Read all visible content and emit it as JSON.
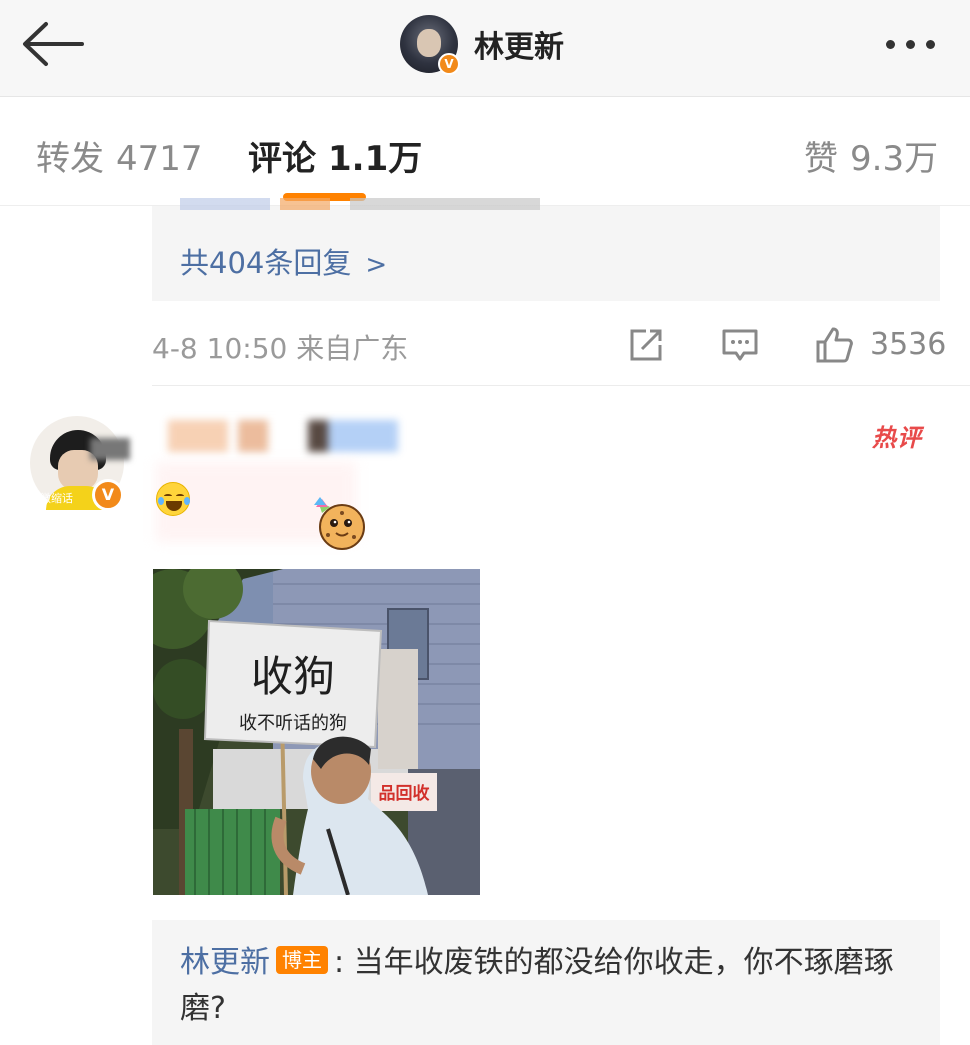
{
  "header": {
    "title": "林更新",
    "avatar_badge": "V"
  },
  "tabs": [
    {
      "label": "转发",
      "count": "4717"
    },
    {
      "label": "评论",
      "count": "1.1万"
    },
    {
      "label": "赞",
      "count": "9.3万"
    }
  ],
  "previous_comment": {
    "more_replies": "共404条回复",
    "time_location": "4-8 10:50 来自广东",
    "like_count": "3536"
  },
  "hot_comment": {
    "hot_label": "热评",
    "avatar_watermark": "微缩话",
    "photo": {
      "sign_main": "收狗",
      "sign_sub": "收不听话的狗",
      "shop_sign": "品回收"
    },
    "reply": {
      "author": "林更新",
      "tag": "博主",
      "text": ": 当年收废铁的都没给你收走，你不琢磨琢磨?"
    }
  },
  "colors": {
    "accent": "#ff8200",
    "link": "#4d6fa3",
    "hot": "#e84a4a"
  }
}
